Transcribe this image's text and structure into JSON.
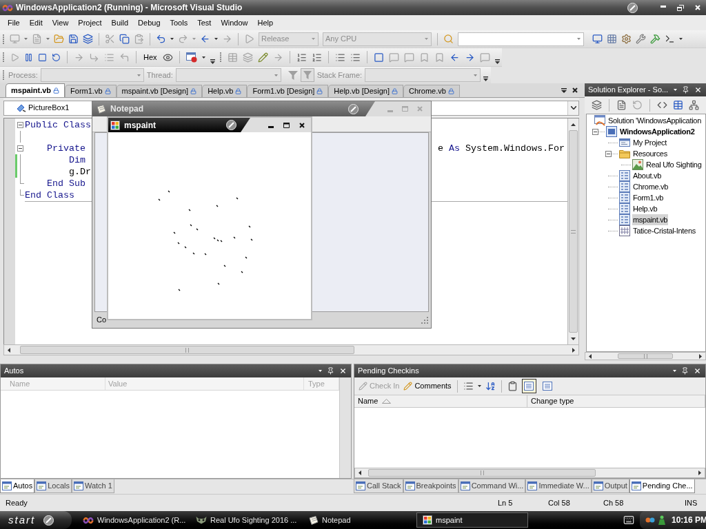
{
  "title_bar": {
    "title": "WindowsApplication2 (Running) - Microsoft Visual Studio"
  },
  "menu_bar": [
    "File",
    "Edit",
    "View",
    "Project",
    "Build",
    "Debug",
    "Tools",
    "Test",
    "Window",
    "Help"
  ],
  "standard_toolbar": {
    "configuration": {
      "value": "Release",
      "disabled": true
    },
    "platform": {
      "value": "Any CPU",
      "disabled": true
    }
  },
  "debug_toolbar": {
    "hex_label": "Hex"
  },
  "debug_location_toolbar": {
    "process_label": "Process:",
    "thread_label": "Thread:",
    "stack_frame_label": "Stack Frame:"
  },
  "document_tabs": [
    {
      "label": "mspaint.vb",
      "selected": true
    },
    {
      "label": "Form1.vb",
      "selected": false
    },
    {
      "label": "mspaint.vb [Design]",
      "selected": false
    },
    {
      "label": "Help.vb",
      "selected": false
    },
    {
      "label": "Form1.vb [Design]",
      "selected": false
    },
    {
      "label": "Help.vb [Design]",
      "selected": false
    },
    {
      "label": "Chrome.vb",
      "selected": false
    }
  ],
  "editor": {
    "object_combo": "PictureBox1",
    "lines": [
      {
        "kind": "code",
        "modified": false,
        "expanded": true,
        "segments": [
          {
            "text": "Public Class",
            "kind": "keyword"
          }
        ],
        "children": [
          {
            "kind": "blank"
          },
          {
            "kind": "code",
            "modified": false,
            "expanded": true,
            "segments": [
              {
                "text": "Private",
                "kind": "keyword"
              }
            ],
            "tail": [
              {
                "text": "e ",
                "kind": "plain"
              },
              {
                "text": "As",
                "kind": "keyword"
              },
              {
                "text": " System.Windows.For",
                "kind": "plain"
              }
            ],
            "children": [
              {
                "kind": "code",
                "modified": true,
                "segments": [
                  {
                    "text": "Dim",
                    "kind": "keyword"
                  }
                ]
              },
              {
                "kind": "code",
                "modified": true,
                "segments": [
                  {
                    "text": "g.Dr",
                    "kind": "plain"
                  }
                ]
              }
            ]
          },
          {
            "kind": "code",
            "modified": false,
            "segments": [
              {
                "text": "End Sub",
                "kind": "keyword"
              }
            ]
          }
        ]
      },
      {
        "kind": "code",
        "modified": false,
        "segments": [
          {
            "text": "End Class",
            "kind": "keyword"
          }
        ]
      }
    ]
  },
  "notepad_window": {
    "title": "Notepad",
    "status_text": "Co"
  },
  "mspaint_window": {
    "title": "mspaint"
  },
  "solution_explorer": {
    "title": "Solution Explorer - So...",
    "tree": [
      {
        "label": "Solution 'WindowsApplication",
        "kind": "solution",
        "selected": false,
        "children": [
          {
            "label": "WindowsApplication2",
            "kind": "project",
            "selected": false,
            "expanded": true,
            "children": [
              {
                "label": "My Project",
                "kind": "properties",
                "selected": false
              },
              {
                "label": "Resources",
                "kind": "folder",
                "selected": false,
                "expanded": true,
                "children": [
                  {
                    "label": "Real Ufo Sighting",
                    "kind": "image",
                    "selected": false
                  }
                ]
              },
              {
                "label": "About.vb",
                "kind": "code_file",
                "selected": false
              },
              {
                "label": "Chrome.vb",
                "kind": "code_file",
                "selected": false
              },
              {
                "label": "Form1.vb",
                "kind": "code_file",
                "selected": false
              },
              {
                "label": "Help.vb",
                "kind": "code_file",
                "selected": false
              },
              {
                "label": "mspaint.vb",
                "kind": "code_file",
                "selected": true
              },
              {
                "label": "Tatice-Cristal-Intens",
                "kind": "resource",
                "selected": false
              }
            ]
          }
        ]
      }
    ]
  },
  "autos_panel": {
    "title": "Autos",
    "columns": [
      "Name",
      "Value",
      "Type"
    ]
  },
  "pending_checkins_panel": {
    "title": "Pending Checkins",
    "actions": [
      {
        "label": "Check In",
        "disabled": true
      },
      {
        "label": "Comments",
        "disabled": false
      }
    ],
    "view_buttons": [
      {
        "selected": true
      },
      {
        "selected": false
      }
    ],
    "columns": [
      {
        "label": "Name",
        "sorted": true
      },
      {
        "label": "Change type",
        "sorted": false
      }
    ]
  },
  "tool_tabs_left": [
    {
      "label": "Autos",
      "selected": true
    },
    {
      "label": "Locals",
      "selected": false
    },
    {
      "label": "Watch 1",
      "selected": false
    }
  ],
  "tool_tabs_right": [
    {
      "label": "Call Stack",
      "selected": false
    },
    {
      "label": "Breakpoints",
      "selected": false
    },
    {
      "label": "Command Wi...",
      "selected": false
    },
    {
      "label": "Immediate W...",
      "selected": false
    },
    {
      "label": "Output",
      "selected": false
    },
    {
      "label": "Pending Che...",
      "selected": true
    }
  ],
  "status_bar": {
    "message": "Ready",
    "line": "Ln 5",
    "column": "Col 58",
    "character": "Ch 58",
    "mode": "INS"
  },
  "taskbar": {
    "start_label": "start",
    "tasks": [
      {
        "label": "WindowsApplication2 (R...",
        "kind": "ide",
        "selected": false
      },
      {
        "label": "Real Ufo Sighting 2016 ...",
        "kind": "video",
        "selected": false
      },
      {
        "label": "Notepad",
        "kind": "notepad",
        "selected": false
      },
      {
        "label": "mspaint",
        "kind": "paint",
        "selected": true
      }
    ],
    "clock": "10:16 PM"
  }
}
